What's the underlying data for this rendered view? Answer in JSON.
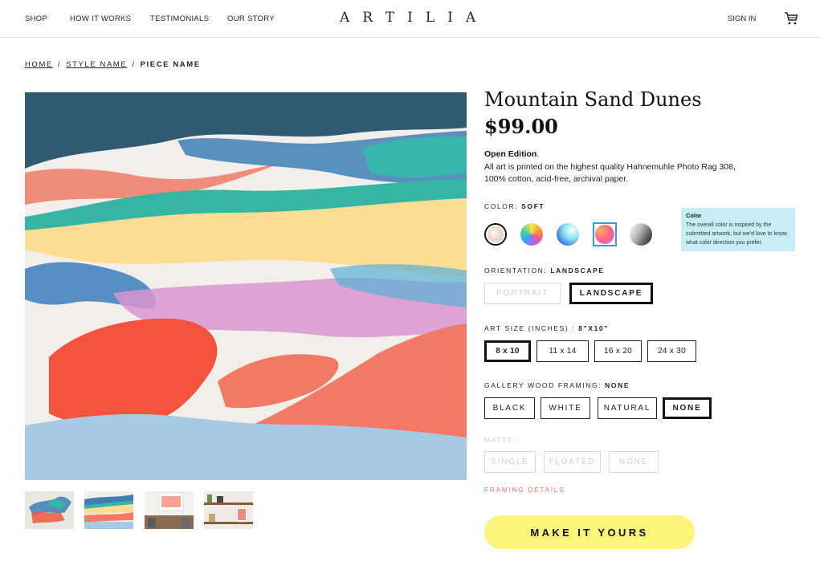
{
  "brand": {
    "logo": "ARTILIA"
  },
  "nav": {
    "items": [
      "SHOP",
      "HOW IT WORKS",
      "TESTIMONIALS",
      "OUR STORY"
    ],
    "sign_in": "SIGN IN",
    "cart_icon": "cart-icon"
  },
  "breadcrumb": {
    "home": "HOME",
    "style": "STYLE NAME",
    "piece": "PIECE NAME",
    "separator": "/"
  },
  "product": {
    "title": "Mountain Sand Dunes",
    "price": "$99.00",
    "edition": "Open Edition",
    "edition_suffix": ".",
    "description": "All art is printed on the highest quality Hahnemuhle Photo Rag 308, 100% cotton, acid-free, archival paper."
  },
  "color": {
    "label": "COLOR: ",
    "selected": "SOFT",
    "swatches": [
      {
        "name": "soft",
        "colors": [
          "#f5d7c8",
          "#a7d8e8"
        ],
        "selected": true
      },
      {
        "name": "bright",
        "colors": [
          "#ffe24d",
          "#27b3e6",
          "#f05a8a"
        ]
      },
      {
        "name": "ocean",
        "colors": [
          "#3a78e8",
          "#8ae0f0",
          "#ffffff"
        ]
      },
      {
        "name": "warm",
        "colors": [
          "#ff5f8a",
          "#ffb25a",
          "#c870ff"
        ],
        "highlight": "#2e9ce6"
      },
      {
        "name": "mono",
        "colors": [
          "#111111",
          "#ffffff"
        ]
      }
    ],
    "tooltip_title": "Color",
    "tooltip_body": "The overall color is inspired by the submitted artwork, but we'd love to know what color direction you prefer."
  },
  "orientation": {
    "label": "ORIENTATION: ",
    "selected": "LANDSCAPE",
    "options": [
      "PORTRAIT",
      "LANDSCAPE"
    ]
  },
  "size": {
    "label": "ART SIZE (INCHES) : ",
    "selected": "8”x10”",
    "options": [
      "8 x 10",
      "11 x 14",
      "16 x 20",
      "24 x 30"
    ]
  },
  "framing": {
    "label": "GALLERY WOOD FRAMING: ",
    "selected": "NONE",
    "options": [
      "BLACK",
      "WHITE",
      "NATURAL",
      "NONE"
    ]
  },
  "matte": {
    "label": "MATTE:",
    "options": [
      "SINGLE",
      "FLOATED",
      "NONE"
    ]
  },
  "framing_details": "FRAMING DETAILS",
  "cta": "MAKE IT YOURS",
  "colors": {
    "accent_yellow": "#fbf57b",
    "accent_coral": "#e8786a",
    "tooltip_bg": "#c6eef4"
  }
}
